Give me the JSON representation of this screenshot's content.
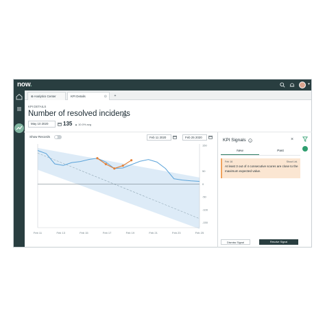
{
  "app": {
    "logo": "now",
    "logo_dot": "."
  },
  "tabs": [
    {
      "label": "Analytics Center"
    },
    {
      "label": "KPI Details"
    }
  ],
  "tab_add": "+",
  "header": {
    "kpi_label": "KPI DETAILS",
    "title": "Number of resolved incidents",
    "date": "May 10 2020",
    "value": "135",
    "delta": "▲ 10.0% avg"
  },
  "chart_controls": {
    "show_records": "Show Records",
    "start_date": "Feb 11 2020",
    "end_date": "Feb 25 2020"
  },
  "chart_data": {
    "type": "line",
    "x": [
      "Feb 11",
      "Feb 13",
      "Feb 15",
      "Feb 17",
      "Feb 19",
      "Feb 21",
      "Feb 23",
      "Feb 25"
    ],
    "y_ticks": [
      "150",
      "50",
      "0",
      "-50",
      "-100",
      "-150"
    ],
    "ylim": [
      -170,
      150
    ],
    "series": [
      {
        "values": [
          130,
          118,
          78,
          72,
          83,
          87,
          95,
          100,
          85,
          60,
          62,
          75,
          88,
          95,
          85,
          60,
          20,
          15,
          12,
          10
        ]
      },
      {
        "values": [
          100,
          77,
          60,
          71,
          92
        ]
      }
    ],
    "highlight_range": [
      7,
      11
    ],
    "band_upper": [
      140,
      25
    ],
    "band_lower": [
      55,
      -175
    ],
    "trend": [
      120,
      -135
    ],
    "colors": {
      "line": "#5ba3d9",
      "signal": "#e3823a",
      "band": "#d4e6f5",
      "trend": "#8fa6b3"
    }
  },
  "signals": {
    "title": "KPI Signals",
    "close": "×",
    "tabs": [
      "New",
      "Past"
    ],
    "card": {
      "date": "Feb 16",
      "tag": "Shout Ltd.",
      "text": "At least 3 out of 4 consecutive scores are close to the maximum expected value."
    },
    "secondary_button": "Dismiss Signal",
    "primary_button": "Resolve Signal"
  }
}
